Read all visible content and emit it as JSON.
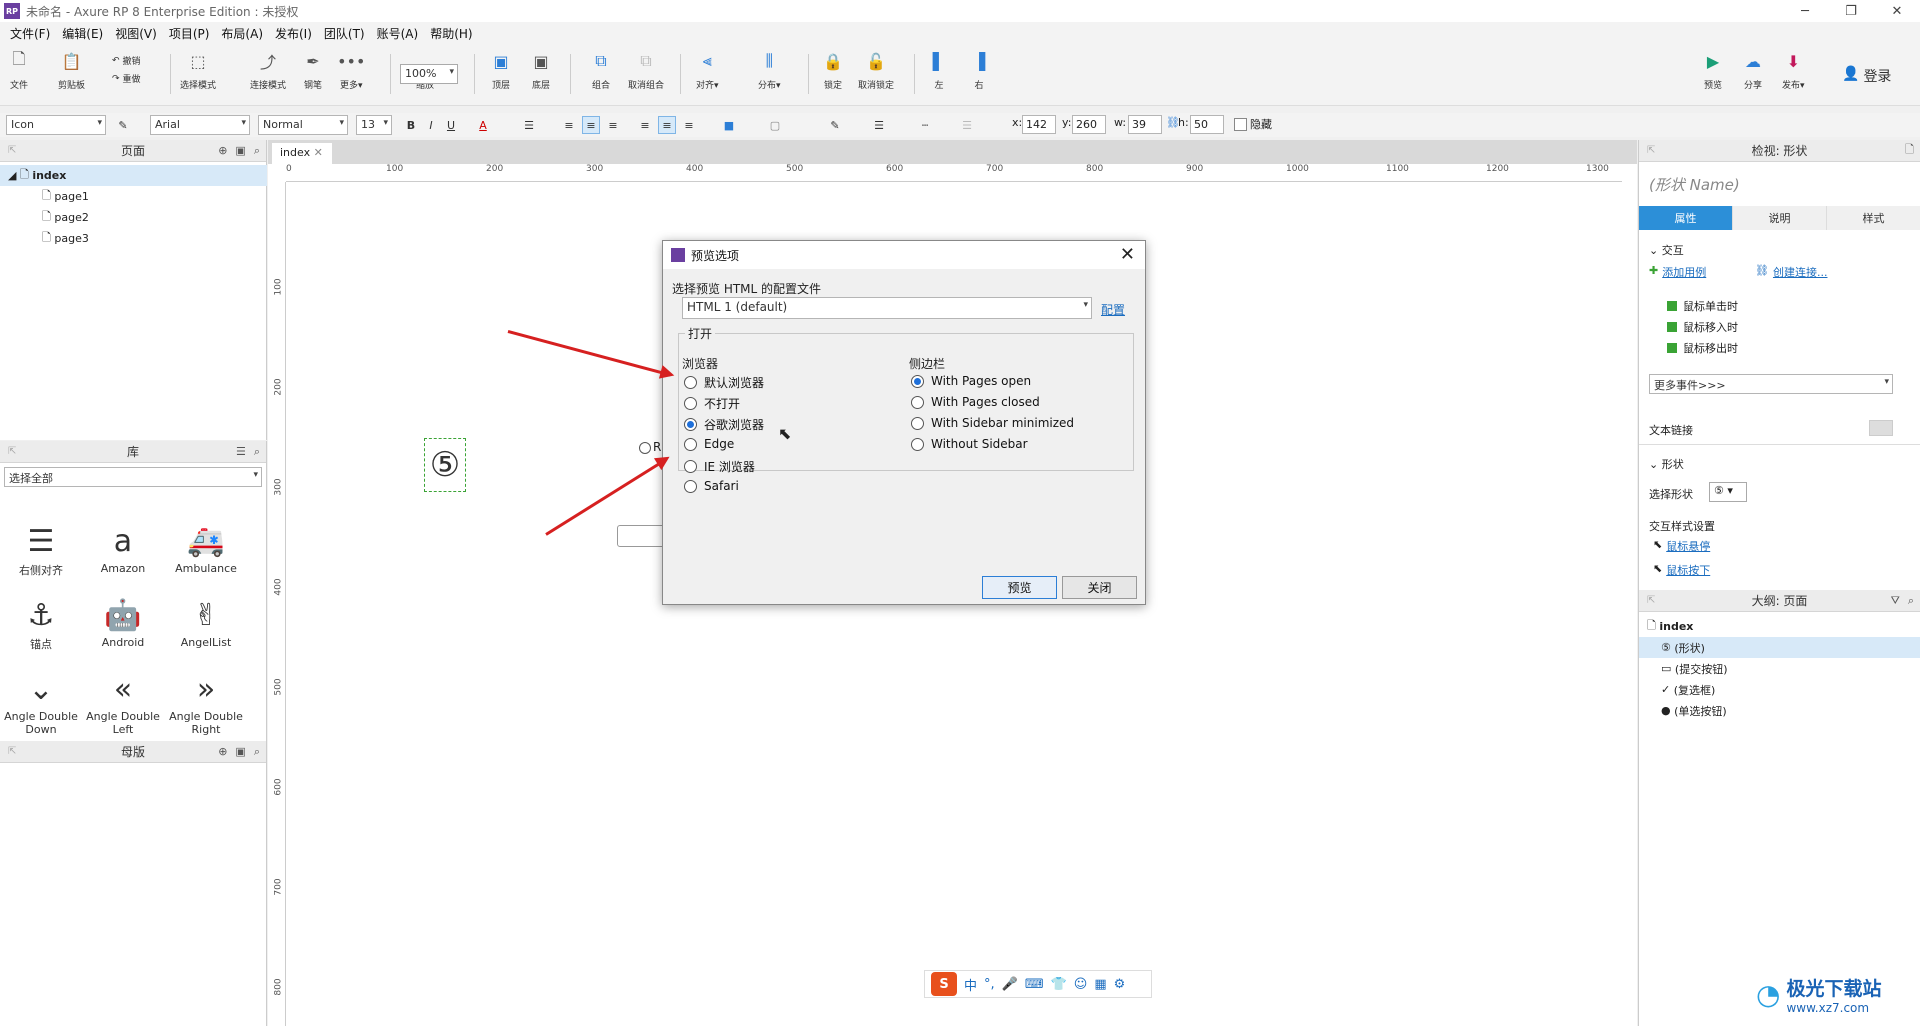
{
  "app": {
    "title": "未命名 - Axure RP 8 Enterprise Edition : 未授权"
  },
  "menu": [
    "文件(F)",
    "编辑(E)",
    "视图(V)",
    "项目(P)",
    "布局(A)",
    "发布(I)",
    "团队(T)",
    "账号(A)",
    "帮助(H)"
  ],
  "toolbar": {
    "file": "文件",
    "clipboard": "剪贴板",
    "undo": "撤销",
    "redo": "重做",
    "select_mode": "选择模式",
    "connect_mode": "连接模式",
    "pen": "钢笔",
    "more": "更多▾",
    "zoom_value": "100%",
    "zoom_label": "缩放",
    "top": "顶层",
    "bottom": "底层",
    "group": "组合",
    "ungroup": "取消组合",
    "align": "对齐▾",
    "distribute": "分布▾",
    "lock": "锁定",
    "unlock": "取消锁定",
    "left": "左",
    "right": "右",
    "preview": "预览",
    "share": "分享",
    "publish": "发布▾",
    "login": "登录"
  },
  "format": {
    "style": "Icon",
    "font": "Arial",
    "weight": "Normal",
    "size": "13",
    "x_label": "x:",
    "x": "142",
    "y_label": "y:",
    "y": "260",
    "w_label": "w:",
    "w": "39",
    "h_label": "h:",
    "h": "50",
    "hidden": "隐藏"
  },
  "pages_panel": {
    "title": "页面",
    "root": "index",
    "pages": [
      "page1",
      "page2",
      "page3"
    ]
  },
  "library_panel": {
    "title": "库",
    "filter": "选择全部",
    "items": [
      {
        "label": "右侧对齐"
      },
      {
        "label": "Amazon"
      },
      {
        "label": "Ambulance"
      },
      {
        "label": "锚点"
      },
      {
        "label": "Android"
      },
      {
        "label": "AngelList"
      },
      {
        "label": "Angle Double Down"
      },
      {
        "label": "Angle Double Left"
      },
      {
        "label": "Angle Double Right"
      }
    ]
  },
  "masters_panel": {
    "title": "母版"
  },
  "canvas": {
    "tab": "index",
    "ruler_h": [
      "0",
      "100",
      "200",
      "300",
      "400",
      "500",
      "600",
      "700",
      "800",
      "900",
      "1000",
      "1100",
      "1200",
      "1300"
    ],
    "ruler_v": [
      "100",
      "200",
      "300",
      "400",
      "500",
      "600",
      "700",
      "800"
    ],
    "radio_fragment": "R"
  },
  "inspector": {
    "title": "检视: 形状",
    "shape_name": "(形状 Name)",
    "tabs": [
      "属性",
      "说明",
      "样式"
    ],
    "interaction": "交互",
    "add_case": "添加用例",
    "create_link": "创建连接...",
    "events": [
      "鼠标单击时",
      "鼠标移入时",
      "鼠标移出时"
    ],
    "more_events": "更多事件>>>",
    "text_link": "文本链接",
    "shape_section": "形状",
    "select_shape": "选择形状",
    "interaction_style": "交互样式设置",
    "hover": "鼠标悬停",
    "mouse_down": "鼠标按下"
  },
  "outline": {
    "title": "大纲: 页面",
    "root": "index",
    "items": [
      "(形状)",
      "(提交按钮)",
      "(复选框)",
      "(单选按钮)"
    ]
  },
  "dialog": {
    "title": "预览选项",
    "config_label": "选择预览 HTML 的配置文件",
    "config_value": "HTML 1 (default)",
    "config_link": "配置",
    "open_group": "打开",
    "browser_label": "浏览器",
    "browsers": [
      {
        "label": "默认浏览器",
        "selected": false
      },
      {
        "label": "不打开",
        "selected": false
      },
      {
        "label": "谷歌浏览器",
        "selected": true
      },
      {
        "label": "Edge",
        "selected": false
      },
      {
        "label": "IE 浏览器",
        "selected": false
      },
      {
        "label": "Safari",
        "selected": false
      }
    ],
    "sidebar_label": "侧边栏",
    "sidebar_options": [
      {
        "label": "With Pages open",
        "selected": true
      },
      {
        "label": "With Pages closed",
        "selected": false
      },
      {
        "label": "With Sidebar minimized",
        "selected": false
      },
      {
        "label": "Without Sidebar",
        "selected": false
      }
    ],
    "preview_button": "预览",
    "close_button": "关闭"
  },
  "ime": {
    "logo": "S",
    "mode": "中"
  },
  "watermark": {
    "name": "极光下载站",
    "url": "www.xz7.com"
  },
  "colors": {
    "accent": "#2c8fd8",
    "arrow": "#d62020",
    "brand": "#6a3fa0"
  }
}
